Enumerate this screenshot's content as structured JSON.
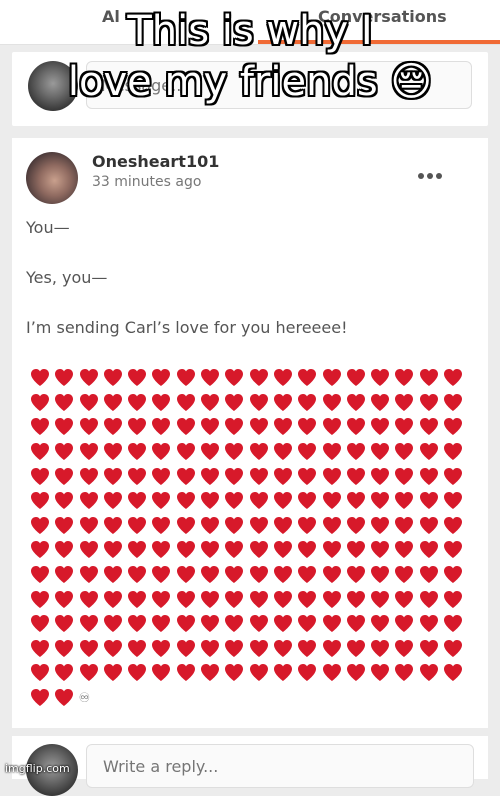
{
  "tabs": {
    "left_label": "Al",
    "right_label": "Conversations",
    "active_color": "#f06a35"
  },
  "compose": {
    "placeholder": "Message..."
  },
  "meme": {
    "caption_line1": "This is why I",
    "caption_line2": "love my friends 😔"
  },
  "post": {
    "username": "Onesheart101",
    "timestamp": "33 minutes ago",
    "more_icon": "more-dots-icon",
    "lines": [
      "You—",
      "Yes, you—",
      "I’m sending Carl’s love for you hereeee!"
    ],
    "heart_rows": 14,
    "hearts_per_row": 18,
    "last_row_hearts": 2,
    "heart_color": "#d7192a",
    "trailing_symbol": "♾"
  },
  "reply": {
    "placeholder": "Write a reply..."
  },
  "watermark": "imgflip.com"
}
